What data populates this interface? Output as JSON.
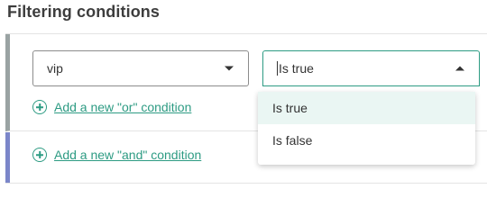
{
  "header": {
    "title": "Filtering conditions"
  },
  "condition": {
    "field_value": "vip",
    "operator_value": "Is true"
  },
  "links": {
    "add_or": "Add a new \"or\" condition",
    "add_and": "Add a new \"and\" condition"
  },
  "dropdown": {
    "options": [
      "Is true",
      "Is false"
    ],
    "selected": "Is true"
  },
  "colors": {
    "accent": "#2d9b83",
    "or_bar": "#9aa3a3",
    "and_bar": "#7b86c9",
    "selected_option_bg": "#eaf6f3"
  },
  "icons": {
    "field_caret": "chevron-down-icon",
    "operator_caret": "chevron-up-icon",
    "add_icon": "plus-circle-icon"
  }
}
